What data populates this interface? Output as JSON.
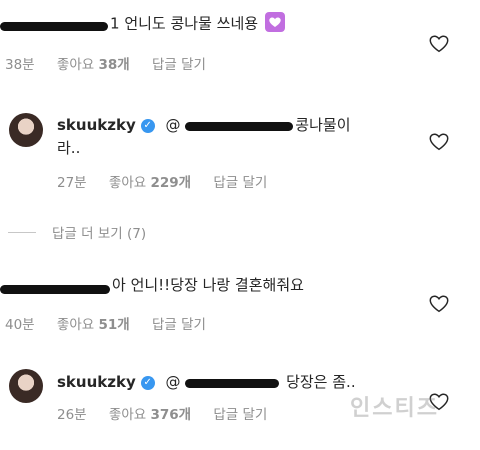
{
  "comments": [
    {
      "text_prefix": "1",
      "text_main": "언니도 콩나물 쓰네용",
      "emoji": "purple-heart-emoji",
      "time": "38분",
      "likes_label": "좋아요",
      "likes_count": "38개",
      "reply_label": "답글 달기"
    },
    {
      "username": "skuukzky",
      "text_line1": "콩나물이",
      "text_line2": "라..",
      "time": "27분",
      "likes_label": "좋아요",
      "likes_count": "229개",
      "reply_label": "답글 달기"
    },
    {
      "text_main": "아 언니!!당장 나랑 결혼해줘요",
      "time": "40분",
      "likes_label": "좋아요",
      "likes_count": "51개",
      "reply_label": "답글 달기"
    },
    {
      "username": "skuukzky",
      "text_main": "당장은 좀..",
      "time": "26분",
      "likes_label": "좋아요",
      "likes_count": "376개",
      "reply_label": "답글 달기"
    }
  ],
  "view_replies": "답글 더 보기 (7)",
  "watermark": "인스티즈",
  "colors": {
    "text": "#262626",
    "meta": "#8e8e8e",
    "verified": "#3897f0",
    "heart_emoji": "#c16ee0"
  }
}
